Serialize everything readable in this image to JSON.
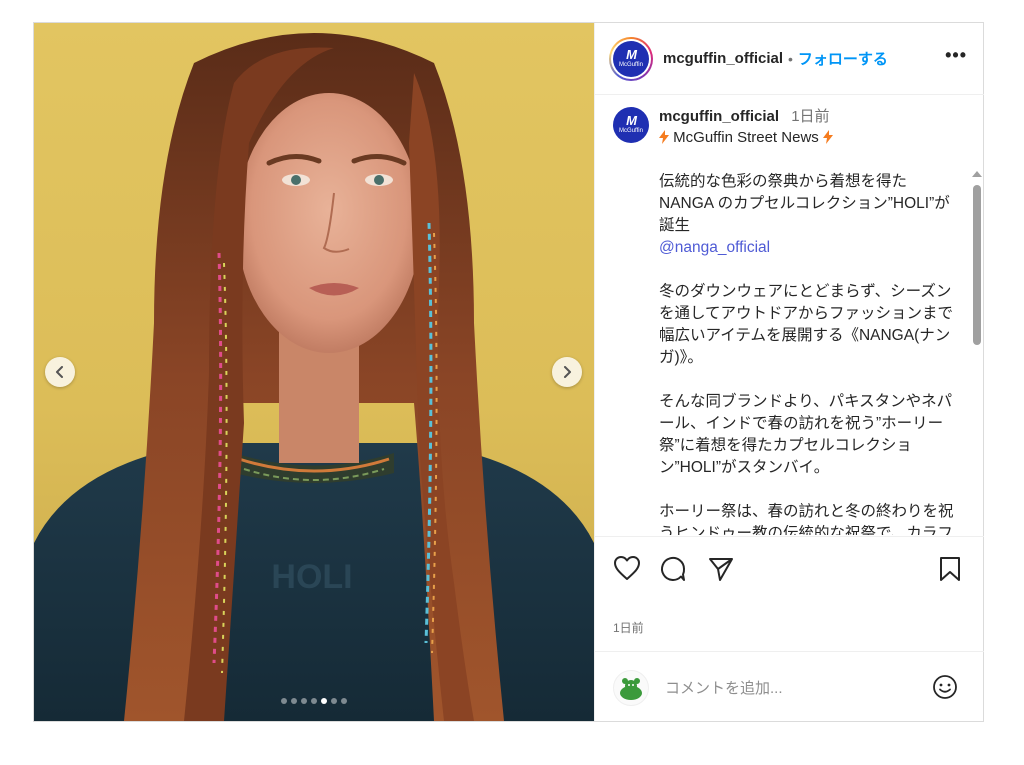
{
  "post": {
    "username": "mcguffin_official",
    "separator": "•",
    "follow_label": "フォローする",
    "more_label": "•••",
    "avatar_mark": "M",
    "avatar_text": "McGuffin"
  },
  "media": {
    "slide_count": 7,
    "active_index": 4,
    "icons": {
      "prev": "chevron-left-icon",
      "next": "chevron-right-icon"
    },
    "sweater_text": "HOLI"
  },
  "caption": {
    "username": "mcguffin_official",
    "time": "1日前",
    "headline": "McGuffin Street News",
    "paragraph1": "伝統的な色彩の祭典から着想を得た NANGA のカプセルコレクション”HOLI”が誕生",
    "mention": "@nanga_official",
    "paragraph2": "冬のダウンウェアにとどまらず、シーズンを通してアウトドアからファッションまで幅広いアイテムを展開する《NANGA(ナンガ)》。",
    "paragraph3": "そんな同ブランドより、パキスタンやネパール、インドで春の訪れを祝う”ホーリー祭”に着想を得たカプセルコレクション”HOLI”がスタンバイ。",
    "paragraph4": "ホーリー祭は、春の訪れと冬の終わりを祝うヒンドゥー教の伝統的な祝祭で、カラフルな色粉を投げ合いながら"
  },
  "actions": {
    "icons": [
      "heart-icon",
      "comment-icon",
      "share-icon",
      "bookmark-icon"
    ],
    "date": "1日前"
  },
  "comment": {
    "placeholder": "コメントを追加...",
    "emoji_icon": "emoji-icon"
  },
  "colors": {
    "follow": "#0095f6",
    "mention": "#4f5bd5",
    "brand_avatar": "#1f2fb2",
    "bolt": "#f57c1f"
  }
}
